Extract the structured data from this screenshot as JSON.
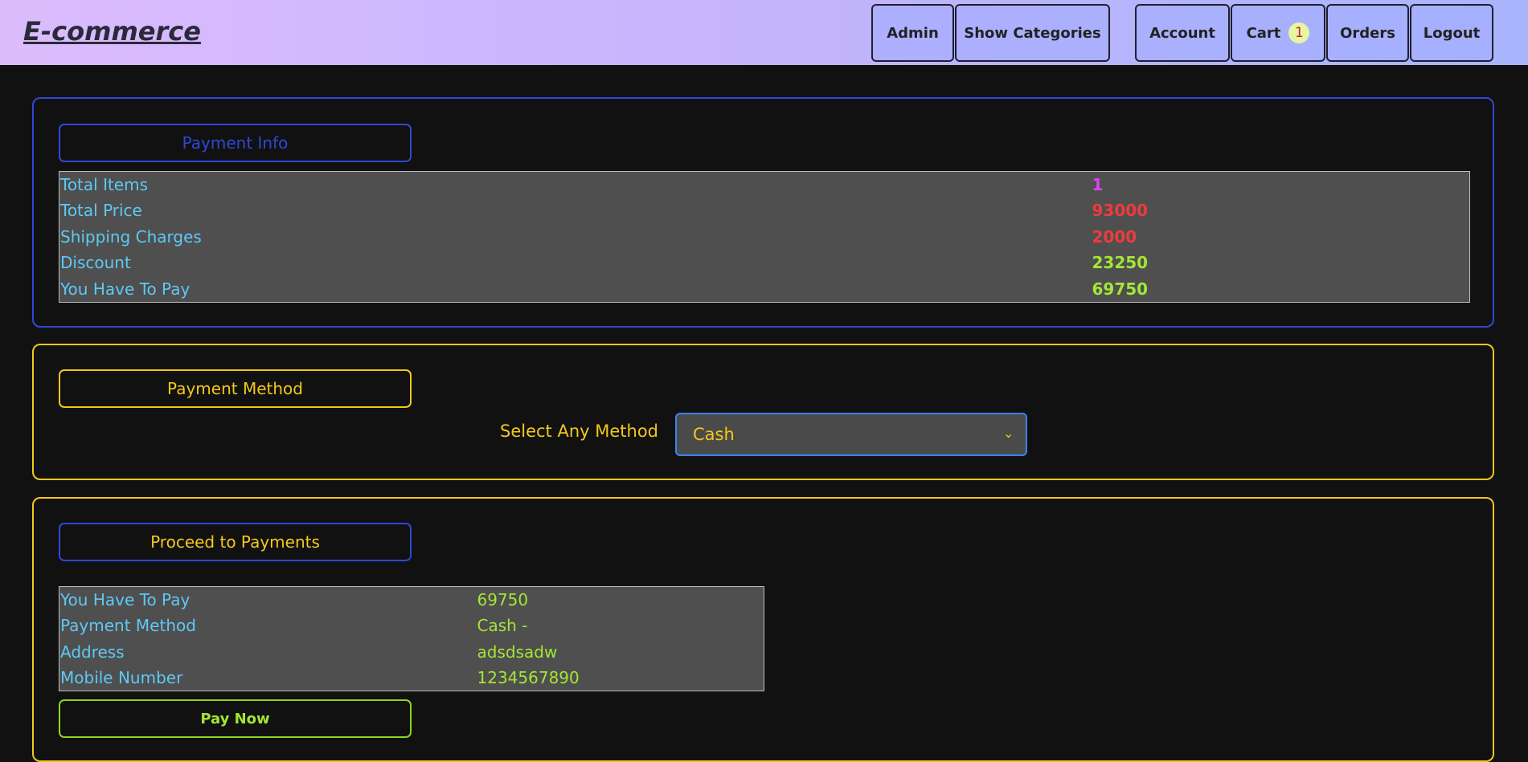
{
  "header": {
    "brand": "E-commerce",
    "admin": "Admin",
    "show_categories": "Show Categories",
    "account": "Account",
    "cart": "Cart",
    "cart_count": "1",
    "orders": "Orders",
    "logout": "Logout"
  },
  "payment_info": {
    "title": "Payment Info",
    "rows": [
      {
        "label": "Total Items",
        "value": "1"
      },
      {
        "label": "Total Price",
        "value": "93000"
      },
      {
        "label": "Shipping Charges",
        "value": "2000"
      },
      {
        "label": "Discount",
        "value": "23250"
      },
      {
        "label": "You Have To Pay",
        "value": "69750"
      }
    ]
  },
  "payment_method": {
    "title": "Payment Method",
    "select_label": "Select Any Method",
    "selected": "Cash"
  },
  "proceed": {
    "title": "Proceed to Payments",
    "rows": [
      {
        "label": "You Have To Pay",
        "value": "69750"
      },
      {
        "label": "Payment Method",
        "value": "Cash -"
      },
      {
        "label": "Address",
        "value": "adsdsadw"
      },
      {
        "label": "Mobile Number",
        "value": "1234567890"
      }
    ],
    "pay_button": "Pay Now"
  },
  "colors": {
    "blue_border": "#2f48d6",
    "yellow_border": "#f4c81a",
    "label_cyan": "#5ec9f5",
    "value_green": "#a3e635",
    "value_red": "#ef3b3b",
    "value_magenta": "#d946ef"
  }
}
